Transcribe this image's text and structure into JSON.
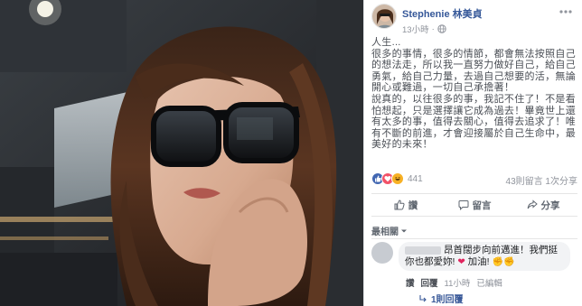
{
  "post": {
    "author": "Stephenie 林美貞",
    "time": "13小時",
    "privacy_icon": "globe-icon",
    "body": "人生...\n很多的事情，很多的情節，都會無法按照自己的想法走，所以我一直努力做好自己，給自己勇氣，給自己力量，去過自己想要的活，無論開心或難過，一切自己承擔著！\n說真的，以往很多的事，我記不住了！不是看怕想起，只是選擇讓它成為過去！畢竟世上還有太多的事，值得去關心，值得去追求了！唯有不斷的前進，才會迎接屬於自己生命中，最美好的未來！"
  },
  "stats": {
    "reaction_count": "441",
    "comments_shares": "43則留言 1次分享",
    "reaction_icons": [
      "like-icon",
      "love-icon",
      "haha-icon"
    ]
  },
  "actions": {
    "like": "讚",
    "comment": "留言",
    "share": "分享"
  },
  "comments": {
    "sort_label": "最相關",
    "first": {
      "text_part1": "昂首闊步向前邁進！我們挺你也都愛妳!",
      "text_part2": "加油!",
      "time": "11小時",
      "edited": "已編輯",
      "like": "讚",
      "reply": "回覆",
      "reply_count": "1則回覆"
    }
  },
  "colors": {
    "link_blue": "#365899",
    "like_blue": "#4267b2",
    "love_red": "#f25268",
    "haha_yellow": "#f7b125"
  }
}
